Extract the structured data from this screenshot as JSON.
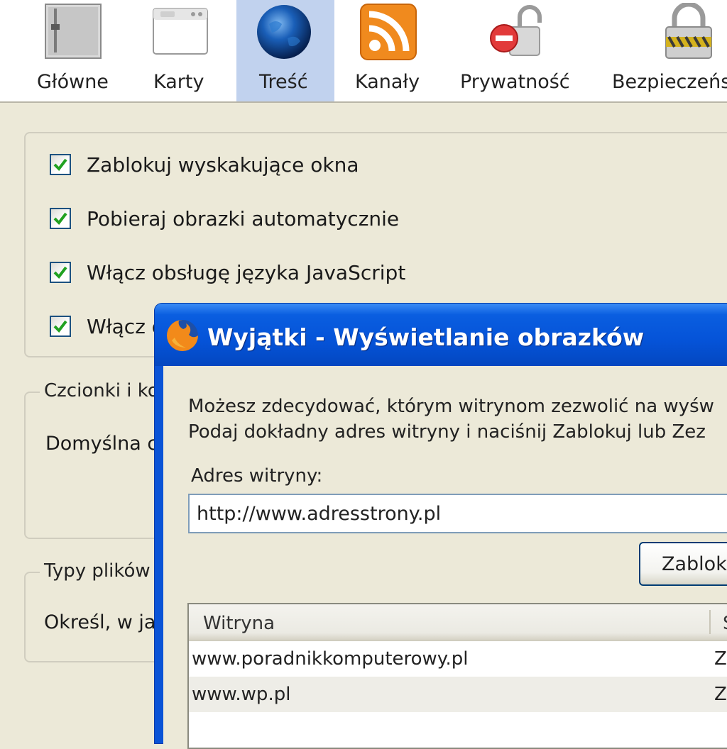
{
  "toolbar": {
    "items": [
      {
        "label": "Główne",
        "icon": "main-settings-icon",
        "selected": false
      },
      {
        "label": "Karty",
        "icon": "tabs-window-icon",
        "selected": false
      },
      {
        "label": "Treść",
        "icon": "globe-icon",
        "selected": true
      },
      {
        "label": "Kanały",
        "icon": "rss-feed-icon",
        "selected": false
      },
      {
        "label": "Prywatność",
        "icon": "privacy-lock-icon",
        "selected": false
      },
      {
        "label": "Bezpieczeńs",
        "icon": "security-padlock-icon",
        "selected": false
      }
    ]
  },
  "content": {
    "checkboxes": [
      {
        "label": "Zablokuj wyskakujące okna",
        "checked": true
      },
      {
        "label": "Pobieraj obrazki automatycznie",
        "checked": true
      },
      {
        "label": "Włącz obsługę języka JavaScript",
        "checked": true
      },
      {
        "label": "Włącz o",
        "checked": true
      }
    ],
    "fonts_group": {
      "legend": "Czcionki i ko",
      "text": "Domyślna c"
    },
    "filetypes_group": {
      "legend": "Typy plików",
      "text": "Określ, w ja"
    }
  },
  "dialog": {
    "title": "Wyjątki - Wyświetlanie obrazków",
    "description_line1": "Możesz zdecydować, którym witrynom zezwolić na wyśw",
    "description_line2": "Podaj dokładny adres witryny i naciśnij Zablokuj lub Zez",
    "address_label": "Adres witryny:",
    "address_value": "http://www.adresstrony.pl",
    "block_button": "Zablok",
    "columns": {
      "site": "Witryna",
      "status": "S"
    },
    "rows": [
      {
        "site": "www.poradnikkomputerowy.pl",
        "status": "Z"
      },
      {
        "site": "www.wp.pl",
        "status": "Z"
      }
    ]
  },
  "colors": {
    "window_bg": "#ece9d8",
    "selected_tab": "#c1d2ee",
    "titlebar_blue": "#0553d8",
    "checkbox_check": "#21a121"
  }
}
